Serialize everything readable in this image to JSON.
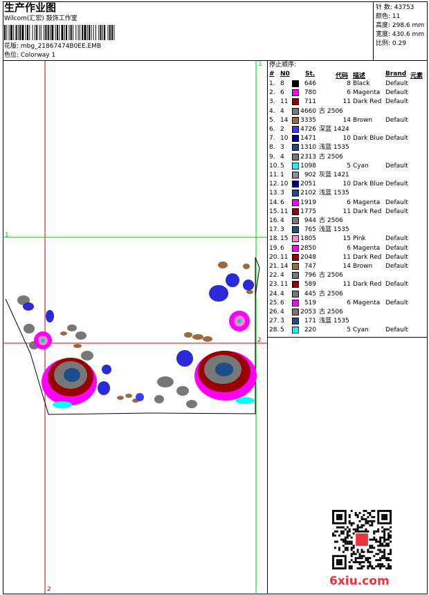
{
  "header": {
    "title": "生产作业图",
    "company": "Wilcom(汇宏) 鼓饰工作室",
    "design_label": "花版: mbg_21867474B0EE.EMB",
    "colorway_label": "色位:  Colorway 1"
  },
  "stats": [
    {
      "label": "针 数:",
      "value": "43753"
    },
    {
      "label": "颜色:",
      "value": "11"
    },
    {
      "label": "高度:",
      "value": "298.6 mm"
    },
    {
      "label": "宽度:",
      "value": "430.6 mm"
    },
    {
      "label": "比例:",
      "value": "0.29"
    }
  ],
  "sequence": {
    "title": "停止顺序:",
    "headers": {
      "num": "#",
      "n": "N0",
      "st": "St.",
      "code": "代码",
      "desc": "描述",
      "brand": "Brand",
      "elem": "元素"
    },
    "rows": [
      {
        "num": "1.",
        "n": "8",
        "color": "#000000",
        "st": "646",
        "code": "8",
        "desc": "Black",
        "brand": "Default"
      },
      {
        "num": "2.",
        "n": "6",
        "color": "#ff00ff",
        "st": "780",
        "code": "6",
        "desc": "Magenta",
        "brand": "Default"
      },
      {
        "num": "3.",
        "n": "11",
        "color": "#990000",
        "st": "711",
        "code": "11",
        "desc": "Dark Red",
        "brand": "Default"
      },
      {
        "num": "4.",
        "n": "4",
        "color": "#777777",
        "st": "4660",
        "code": "古 2506",
        "desc": "",
        "brand": ""
      },
      {
        "num": "5.",
        "n": "14",
        "color": "#9c6a3c",
        "st": "3335",
        "code": "14",
        "desc": "Brown",
        "brand": "Default"
      },
      {
        "num": "6.",
        "n": "2",
        "color": "#3b3bff",
        "st": "4726",
        "code": "深蓝 1424",
        "desc": "",
        "brand": ""
      },
      {
        "num": "7.",
        "n": "10",
        "color": "#000099",
        "st": "1471",
        "code": "10",
        "desc": "Dark Blue",
        "brand": "Default"
      },
      {
        "num": "8.",
        "n": "3",
        "color": "#1d4e8c",
        "st": "1310",
        "code": "浅蓝 1535",
        "desc": "",
        "brand": ""
      },
      {
        "num": "9.",
        "n": "4",
        "color": "#777777",
        "st": "2313",
        "code": "古 2506",
        "desc": "",
        "brand": ""
      },
      {
        "num": "10.",
        "n": "5",
        "color": "#00ffff",
        "st": "1098",
        "code": "5",
        "desc": "Cyan",
        "brand": "Default"
      },
      {
        "num": "11.",
        "n": "1",
        "color": "#8a8aa0",
        "st": "902",
        "code": "灰蓝 1421",
        "desc": "",
        "brand": ""
      },
      {
        "num": "12.",
        "n": "10",
        "color": "#000099",
        "st": "2051",
        "code": "10",
        "desc": "Dark Blue",
        "brand": "Default"
      },
      {
        "num": "13.",
        "n": "3",
        "color": "#1d4e8c",
        "st": "2102",
        "code": "浅蓝 1535",
        "desc": "",
        "brand": ""
      },
      {
        "num": "14.",
        "n": "6",
        "color": "#ff00ff",
        "st": "1919",
        "code": "6",
        "desc": "Magenta",
        "brand": "Default"
      },
      {
        "num": "15.",
        "n": "11",
        "color": "#990000",
        "st": "1775",
        "code": "11",
        "desc": "Dark Red",
        "brand": "Default"
      },
      {
        "num": "16.",
        "n": "4",
        "color": "#777777",
        "st": "944",
        "code": "古 2506",
        "desc": "",
        "brand": ""
      },
      {
        "num": "17.",
        "n": "3",
        "color": "#1d4e8c",
        "st": "765",
        "code": "浅蓝 1535",
        "desc": "",
        "brand": ""
      },
      {
        "num": "18.",
        "n": "15",
        "color": "#ff88c8",
        "st": "1805",
        "code": "15",
        "desc": "Pink",
        "brand": "Default"
      },
      {
        "num": "19.",
        "n": "6",
        "color": "#ff00ff",
        "st": "2850",
        "code": "6",
        "desc": "Magenta",
        "brand": "Default"
      },
      {
        "num": "20.",
        "n": "11",
        "color": "#990000",
        "st": "2048",
        "code": "11",
        "desc": "Dark Red",
        "brand": "Default"
      },
      {
        "num": "21.",
        "n": "14",
        "color": "#9c6a3c",
        "st": "747",
        "code": "14",
        "desc": "Brown",
        "brand": "Default"
      },
      {
        "num": "22.",
        "n": "4",
        "color": "#777777",
        "st": "796",
        "code": "古 2506",
        "desc": "",
        "brand": ""
      },
      {
        "num": "23.",
        "n": "11",
        "color": "#990000",
        "st": "589",
        "code": "11",
        "desc": "Dark Red",
        "brand": "Default"
      },
      {
        "num": "24.",
        "n": "4",
        "color": "#777777",
        "st": "445",
        "code": "古 2506",
        "desc": "",
        "brand": ""
      },
      {
        "num": "25.",
        "n": "6",
        "color": "#ff00ff",
        "st": "519",
        "code": "6",
        "desc": "Magenta",
        "brand": "Default"
      },
      {
        "num": "26.",
        "n": "4",
        "color": "#777777",
        "st": "2053",
        "code": "古 2506",
        "desc": "",
        "brand": ""
      },
      {
        "num": "27.",
        "n": "3",
        "color": "#1d4e8c",
        "st": "171",
        "code": "浅蓝 1535",
        "desc": "",
        "brand": ""
      },
      {
        "num": "28.",
        "n": "5",
        "color": "#00ffff",
        "st": "220",
        "code": "5",
        "desc": "Cyan",
        "brand": "Default"
      }
    ]
  },
  "guides": {
    "label_1": "1",
    "label_2": "2",
    "vline_color": "#00cc00",
    "hline_color": "#cc0000"
  },
  "watermark": "6xiu.com"
}
